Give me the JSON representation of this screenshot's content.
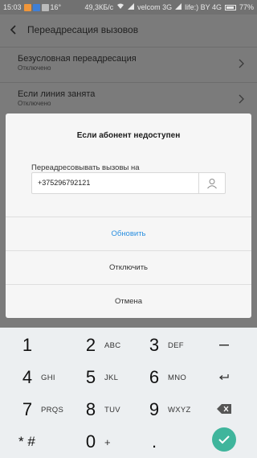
{
  "status_bar": {
    "time": "15:03",
    "temp": "16°",
    "speed": "49,3КБ/с",
    "carrier1": "velcom 3G",
    "carrier2": "life:) BY 4G",
    "battery": "77%"
  },
  "header": {
    "title": "Переадресация вызовов"
  },
  "list": [
    {
      "title": "Безусловная переадресация",
      "subtitle": "Отключено"
    },
    {
      "title": "Если линия занята",
      "subtitle": "Отключено"
    }
  ],
  "dialog": {
    "title": "Если абонент недоступен",
    "field_label": "Переадресовывать вызовы на",
    "phone_value": "+375296792121",
    "buttons": {
      "update": "Обновить",
      "disable": "Отключить",
      "cancel": "Отмена"
    }
  },
  "keypad": {
    "keys": [
      {
        "digit": "1",
        "letters": ""
      },
      {
        "digit": "2",
        "letters": "ABC"
      },
      {
        "digit": "3",
        "letters": "DEF"
      },
      {
        "digit": "4",
        "letters": "GHI"
      },
      {
        "digit": "5",
        "letters": "JKL"
      },
      {
        "digit": "6",
        "letters": "MNO"
      },
      {
        "digit": "7",
        "letters": "PRQS"
      },
      {
        "digit": "8",
        "letters": "TUV"
      },
      {
        "digit": "9",
        "letters": "WXYZ"
      },
      {
        "digit": "* #",
        "letters": ""
      },
      {
        "digit": "0",
        "letters": "+"
      },
      {
        "digit": ".",
        "letters": ""
      }
    ]
  },
  "colors": {
    "accent": "#2a8fe0",
    "confirm": "#3fb59c"
  },
  "icons": [
    "back-arrow-icon",
    "chevron-right-icon",
    "contact-icon",
    "backspace-icon",
    "check-icon",
    "wifi-icon",
    "signal-icon",
    "battery-icon"
  ]
}
